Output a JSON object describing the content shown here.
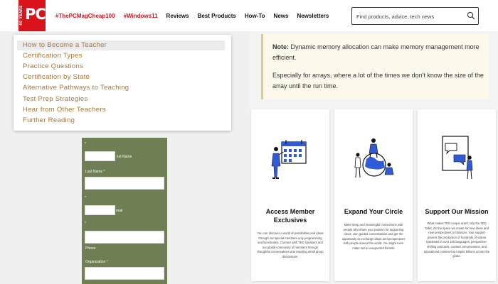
{
  "header": {
    "logo_text": "PC",
    "logo_years": "40 YEARS",
    "nav": [
      {
        "label": "#ThePCMagCheap100",
        "accent": true
      },
      {
        "label": "#Windows11",
        "accent": true
      },
      {
        "label": "Reviews",
        "accent": false
      },
      {
        "label": "Best Products",
        "accent": false
      },
      {
        "label": "How-To",
        "accent": false
      },
      {
        "label": "News",
        "accent": false
      },
      {
        "label": "Newsletters",
        "accent": false
      }
    ],
    "search_placeholder": "Find products, advice, tech news"
  },
  "toc": {
    "items": [
      "How to Become a Teacher",
      "Certification Types",
      "Practice Questions",
      "Certification by State",
      "Alternative Pathways to Teaching",
      "Test Prep Strategies",
      "Hear from Other Teachers",
      "Further Reading"
    ],
    "active_index": 0
  },
  "form": {
    "first_name_label": "irst Name",
    "last_name_label": "Last Name",
    "email_label": "mail",
    "phone_label": "Phone",
    "organization_label": "Organization",
    "required_mark": "*"
  },
  "note": {
    "label": "Note:",
    "text": "Dynamic memory allocation can make memory management more efficient.",
    "paragraph2": "Especially for arrays, where a lot of the times we don't know the size of the array until the run time."
  },
  "cards": [
    {
      "title": "Access Member Exclusives",
      "desc": "You can discover a world of possibilities and ideas through our special members-only programming and livestreams. Connect with TED speakers and our global community of members through thoughtful conversations and inspiring small group discussions.",
      "icon": "calendar-person-icon"
    },
    {
      "title": "Expand Your Circle",
      "desc": "Make deep and meaningful connections with people who share your passion for supporting ideas. Join guided conversations and get the opportunity to exchange ideas and perspectives with people around the world. You might even make some unexpected friends!",
      "icon": "globe-people-icon"
    },
    {
      "title": "Support Our Mission",
      "desc": "What makes TED unique aren't only the TED Talks, it's the space we create for new ideas and new perspectives to blossom. Your support powers the production of hundreds of videos translated in over 100 languages, perspective-shifting podcasts, curated conversations, and educational content that inspire billions across the globe.",
      "icon": "speech-bubbles-icon"
    }
  ],
  "colors": {
    "brand_red": "#d9121b",
    "toc_text": "#b0732f",
    "form_bg": "#6f7f53",
    "note_bg": "#fcf8ec",
    "note_border": "#e3c987",
    "illus_blue": "#2f5bd8"
  }
}
